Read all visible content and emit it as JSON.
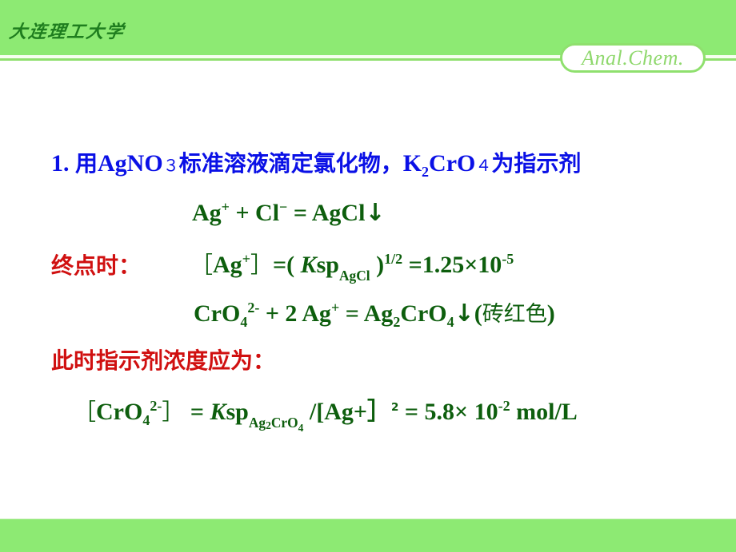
{
  "header": {
    "university": "大连理工大学",
    "badge": "Anal.Chem.",
    "colors": {
      "band": "#8dea73",
      "logo_text": "#1e7d1e",
      "badge_text": "#8fd86d"
    }
  },
  "content": {
    "colors": {
      "heading": "#0a10e6",
      "equation": "#0d5e0d",
      "label": "#d01010"
    },
    "line1": {
      "number": "1.",
      "t1": "用",
      "reagent": "AgNO",
      "reagent_sub": "３",
      "t2": "标准溶液滴定氯化物，",
      "ind_k": "K",
      "ind_k_sub": "2",
      "ind_cro": "CrO",
      "ind_cro_sub": "４",
      "t3": "为指示剂"
    },
    "line2": {
      "ag": "Ag",
      "ag_sup": "+",
      "plus": " + Cl",
      "cl_sup": "−",
      "rest": " = AgCl",
      "arrow": "↓"
    },
    "line3": {
      "label": "终点时：",
      "lbr": "［",
      "ag": "Ag",
      "ag_sup": "+",
      "rbr": "］",
      "eq": "=( ",
      "k": "K",
      "sp": "sp",
      "sp_sub": "AgCl",
      "close": " )",
      "pow": "1/2",
      "val": " =1.25×10",
      "exp": "-5"
    },
    "line4": {
      "cro": "CrO",
      "cro_sub": "4",
      "cro_sup": "2-",
      "mid": " + 2 Ag",
      "ag_sup": "+",
      "eq": " =  Ag",
      "ag_sub": "2",
      "cro2": "CrO",
      "cro2_sub": "4",
      "arrow": "↓",
      "paren_open": "(",
      "color_name": "砖红色",
      "paren_close": ")"
    },
    "line5": {
      "label": "此时指示剂浓度应为："
    },
    "line6": {
      "lbr": "［",
      "cro": "CrO",
      "cro_sub": "4",
      "cro_sup": "2-",
      "rbr": "］",
      "eq": " = ",
      "k": "K",
      "sp": "sp",
      "sp_sub_ag": "Ag",
      "sp_sub_2": "2",
      "sp_sub_cro": "CrO",
      "sp_sub_4": "4",
      "div": " /[Ag+］",
      "sq": "2",
      "val": "  = 5.8× 10",
      "exp": "-2",
      "unit": " mol/L"
    }
  }
}
